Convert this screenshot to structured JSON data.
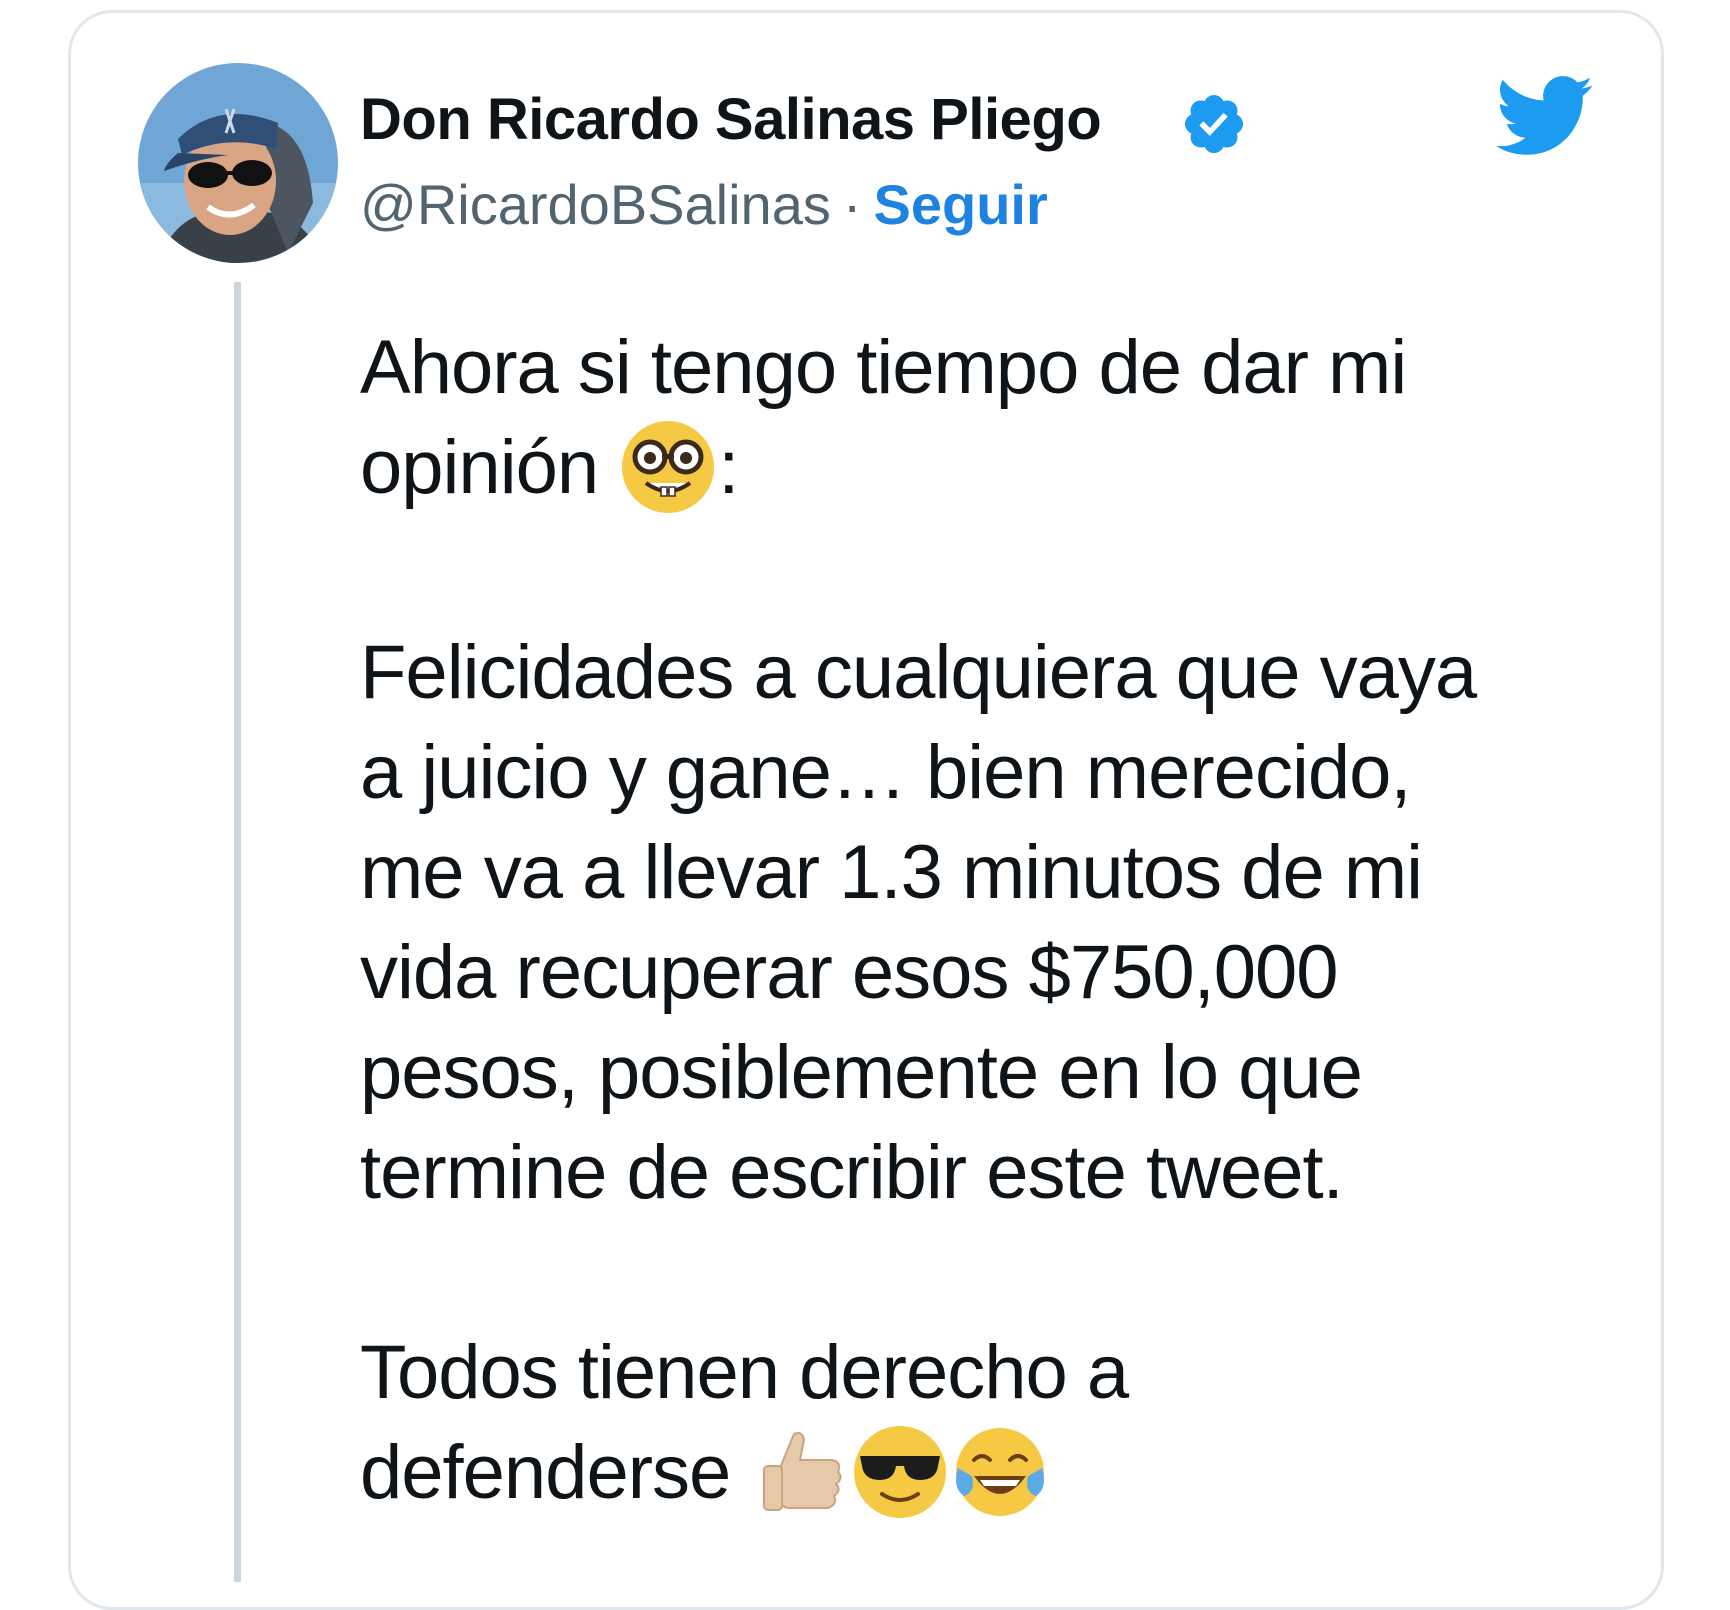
{
  "tweet": {
    "author": {
      "display_name": "Don Ricardo Salinas Pliego",
      "handle": "@RicardoBSalinas",
      "separator": "·",
      "follow_label": "Seguir",
      "verified": true
    },
    "icons": {
      "verified": "verified-badge-icon",
      "platform": "twitter-bird-icon"
    },
    "colors": {
      "link": "#1d82e0",
      "verified": "#1d9bf0",
      "twitter_brand": "#1d9bf0",
      "text": "#0f1419",
      "secondary_text": "#536471",
      "border": "#e1e8ed"
    },
    "body": {
      "p1_line1": "Ahora si tengo tiempo de dar mi",
      "p1_line2": "opinión",
      "p1_emoji": "nerd-face-emoji",
      "p1_colon": ":",
      "p2_line1": "Felicidades a cualquiera que vaya",
      "p2_line2": "a juicio y gane… bien merecido,",
      "p2_line3": "me va a llevar 1.3 minutos de mi",
      "p2_line4": "vida recuperar esos $750,000",
      "p2_line5": "pesos, posiblemente en lo que",
      "p2_line6": "termine de escribir este tweet.",
      "p3_line1": "Todos tienen derecho a",
      "p3_line2": "defenderse",
      "p3_emojis": [
        "thumbs-up-emoji",
        "sunglasses-face-emoji",
        "tears-of-joy-emoji"
      ]
    }
  }
}
